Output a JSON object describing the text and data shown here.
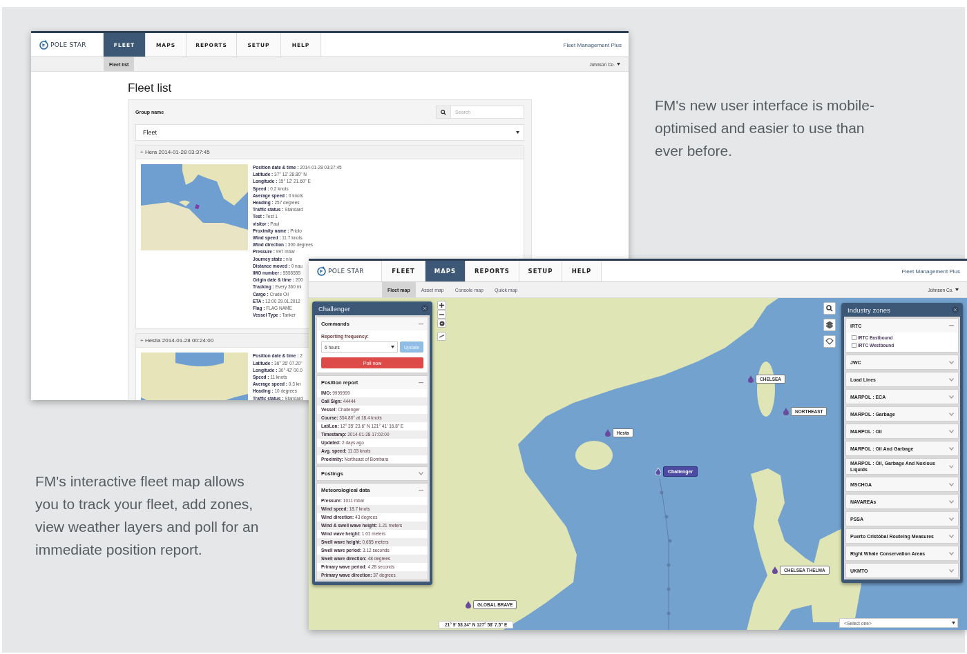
{
  "caption_top": "FM's new user interface is mobile-optimised and easier to use than ever before.",
  "caption_bottom": "FM's interactive fleet map allows you to track your fleet, add zones, view weather layers and poll for an immediate position report.",
  "fleet_list_window": {
    "logo": "POLE STAR",
    "product": "Fleet Management Plus",
    "account": "Johnson Co.",
    "tabs": [
      {
        "label": "FLEET",
        "selected": true
      },
      {
        "label": "MAPS",
        "selected": false
      },
      {
        "label": "REPORTS",
        "selected": false
      },
      {
        "label": "SETUP",
        "selected": false
      },
      {
        "label": "HELP",
        "selected": false
      }
    ],
    "subtabs": [
      {
        "label": "Fleet list",
        "selected": true
      }
    ],
    "title": "Fleet list",
    "group_label": "Group name",
    "search": {
      "placeholder": "Search"
    },
    "group_select": {
      "value": "Fleet"
    },
    "vessels": [
      {
        "header": "+ Hera 2014-01-28 03:37:45",
        "fields": [
          "**Position date & time :** 2014-01-28 03:37:45",
          "**Latitude :** 37° 12' 28.80\" N",
          "**Longitude :** 15° 12' 21.60\" E",
          "**Speed :** 0.2 knots",
          "**Average speed :** 0 knots",
          "**Heading :** 257 degrees",
          "**Traffic status :** Standard",
          "**Test :** Test 1",
          "**visitor :** Paul",
          "**Proximity name :** Priolo",
          "**Wind speed :** 11.7 knots",
          "**Wind direction :** 300 degrees",
          "**Pressure :** 997 mbar",
          "**Journey state :** n/a",
          "**Distance moved :** 0 nau",
          "**IMO number :** 5555555",
          "**Origin date & time :** 200",
          "**Tracking :** Every 360 mi",
          "**Cargo :** Crude Oil",
          "**ETA :** 12:00 29.01.2012",
          "**Flag :** FLAG NAME",
          "**Vessel Type :** Tanker"
        ]
      },
      {
        "header": "+ Hestia 2014-01-28 00:24:00",
        "fields": [
          "**Position date & time :** 2",
          "**Latitude :** 36° 26' 07.20\"",
          "**Longitude :** 30° 42' 00.0",
          "**Speed :** 11 knots",
          "**Average speed :** 0.3 kn",
          "**Heading :** 10 degrees",
          "**Traffic status :** Standard"
        ]
      }
    ]
  },
  "map_window": {
    "logo": "POLE STAR",
    "product": "Fleet Management Plus",
    "account": "Johnson Co.",
    "tabs": [
      {
        "label": "FLEET",
        "selected": false
      },
      {
        "label": "MAPS",
        "selected": true
      },
      {
        "label": "REPORTS",
        "selected": false
      },
      {
        "label": "SETUP",
        "selected": false
      },
      {
        "label": "HELP",
        "selected": false
      }
    ],
    "subtabs": [
      {
        "label": "Fleet map",
        "selected": true
      },
      {
        "label": "Asset map",
        "selected": false
      },
      {
        "label": "Console map",
        "selected": false
      },
      {
        "label": "Quick map",
        "selected": false
      }
    ],
    "vessel_panel": {
      "title": "Challenger",
      "sections": [
        {
          "kind": "commands",
          "title": "Commands",
          "expanded": true,
          "frequency_label": "Reporting frequency:",
          "frequency": "6 hours",
          "update": {
            "label": "Update",
            "disabled": true
          },
          "poll": "Poll now"
        },
        {
          "kind": "list",
          "title": "Position report",
          "expanded": true,
          "rows": [
            "**IMO:** 9999999",
            "**Call Sign:** 44444",
            "**Vessel:** Challenger",
            "**Course:** 354.80° at 18.4 knots",
            "**Lat/Lon:** 12° 35' 23.6\" N 121° 41' 16.8\" E",
            "**Timestamp:** 2014-01-28 17:02:00",
            "**Updated:** 2 days ago",
            "**Avg. speed:** 11.03 knots",
            "**Proximity:** Northeast of Bombara"
          ]
        },
        {
          "kind": "list",
          "title": "Postings",
          "expanded": false
        },
        {
          "kind": "list",
          "title": "Meteorological data",
          "expanded": true,
          "rows": [
            "**Pressure:** 1011 mbar",
            "**Wind speed:** 18.7 knots",
            "**Wind direction:** 43 degrees",
            "**Wind & swell wave height:** 1.21 meters",
            "**Wind wave height:** 1.01 meters",
            "**Swell wave height:** 0.655 meters",
            "**Swell wave period:** 3.12 seconds",
            "**Swell wave direction:** 48 degrees",
            "**Primary wave period:** 4.28 seconds",
            "**Primary wave direction:** 37 degrees"
          ]
        }
      ]
    },
    "zones_panel": {
      "title": "Industry zones",
      "zones": [
        {
          "label": "IRTC",
          "expanded": true,
          "options": [
            {
              "label": "IRTC Eastbound",
              "checked": false
            },
            {
              "label": "IRTC Westbound",
              "checked": false
            }
          ]
        },
        {
          "label": "JWC",
          "expanded": false
        },
        {
          "label": "Load Lines",
          "expanded": false
        },
        {
          "label": "MARPOL : ECA",
          "expanded": false
        },
        {
          "label": "MARPOL : Garbage",
          "expanded": false
        },
        {
          "label": "MARPOL : Oil",
          "expanded": false
        },
        {
          "label": "MARPOL : Oil And Garbage",
          "expanded": false
        },
        {
          "label": "MARPOL : Oil, Garbage And Noxious Liquids",
          "expanded": false
        },
        {
          "label": "MSCHOA",
          "expanded": false
        },
        {
          "label": "NAVAREAs",
          "expanded": false
        },
        {
          "label": "PSSA",
          "expanded": false
        },
        {
          "label": "Puerto Cristóbal Routeing Measures",
          "expanded": false
        },
        {
          "label": "Right Whale Conservation Areas",
          "expanded": false
        },
        {
          "label": "UKMTO",
          "expanded": false
        }
      ]
    },
    "zone_select": {
      "value": "<Select one>"
    },
    "coordinates": "21° 9' 58.34\" N 127° 58' 7.5\" E",
    "vessels": [
      {
        "label": "CHELSEA",
        "selected": false
      },
      {
        "label": "NORTHEAST",
        "selected": false
      },
      {
        "label": "Hesta",
        "selected": false
      },
      {
        "label": "Challenger",
        "selected": true
      },
      {
        "label": "CHELSEA THELMA",
        "selected": false
      },
      {
        "label": "GLOBAL BRAVE",
        "selected": false
      }
    ]
  }
}
